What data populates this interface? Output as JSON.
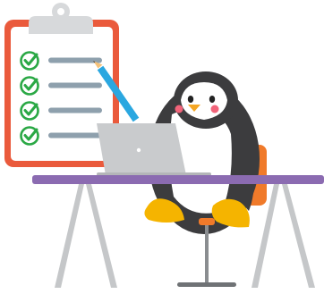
{
  "illustration": {
    "checklist": {
      "item_count": 4,
      "checked_count": 4
    },
    "colors": {
      "clipboard_border": "#ea5a3c",
      "clipboard_paper": "#ffffff",
      "clip": "#d7d9db",
      "check": "#2aa845",
      "list_line": "#8ea0ad",
      "pencil": "#2aa7e0",
      "penguin_body": "#3c3c3e",
      "penguin_belly": "#ffffff",
      "penguin_cheek": "#f2647a",
      "penguin_beak": "#f5a623",
      "penguin_feet": "#f5b400",
      "chair": "#f07a2a",
      "desk_top": "#8b6bb1",
      "desk_legs": "#c5c7c9",
      "laptop": "#c9cbcd"
    }
  }
}
